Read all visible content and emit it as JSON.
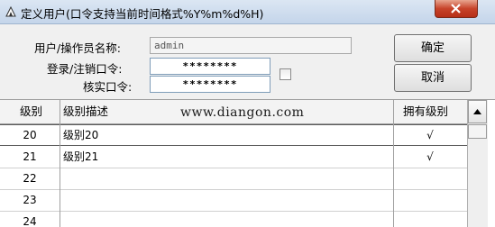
{
  "window": {
    "title": "定义用户(口令支持当前时间格式%Y%m%d%H)"
  },
  "form": {
    "user_label": "用户/操作员名称:",
    "user_value": "admin",
    "login_pw_label": "登录/注销口令:",
    "login_pw_value": "********",
    "verify_pw_label": "核实口令:",
    "verify_pw_value": "********"
  },
  "buttons": {
    "ok": "确定",
    "cancel": "取消"
  },
  "grid": {
    "columns": [
      "级别",
      "级别描述",
      "拥有级别"
    ],
    "watermark": "www.diangon.com",
    "rows": [
      {
        "level": "20",
        "desc": "级别20",
        "owned": "√"
      },
      {
        "level": "21",
        "desc": "级别21",
        "owned": "√"
      },
      {
        "level": "22",
        "desc": "",
        "owned": ""
      },
      {
        "level": "23",
        "desc": "",
        "owned": ""
      },
      {
        "level": "24",
        "desc": "",
        "owned": ""
      }
    ]
  }
}
